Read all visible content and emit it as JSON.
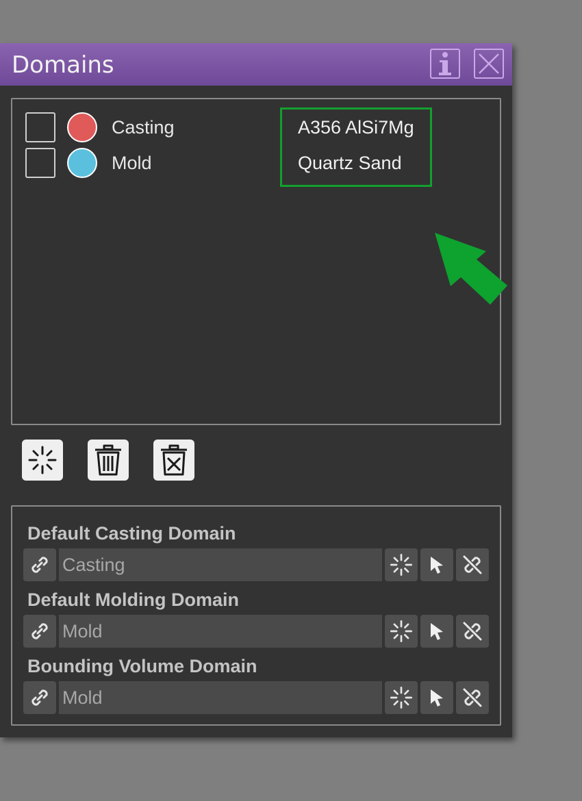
{
  "window": {
    "title": "Domains",
    "info_icon": "info-icon",
    "close_icon": "close-icon"
  },
  "domains": [
    {
      "name": "Casting",
      "material": "A356 AlSi7Mg",
      "color": "#e05a5a",
      "checked": false
    },
    {
      "name": "Mold",
      "material": "Quartz Sand",
      "color": "#5bc0de",
      "checked": false
    }
  ],
  "toolbar": {
    "new_icon": "sparkle-icon",
    "delete_icon": "trash-icon",
    "delete_all_icon": "trash-x-icon"
  },
  "defaults": [
    {
      "label": "Default Casting Domain",
      "value": "Casting"
    },
    {
      "label": "Default Molding Domain",
      "value": "Mold"
    },
    {
      "label": "Bounding Volume Domain",
      "value": "Mold"
    }
  ],
  "colors": {
    "titlebar": "#7b55a3",
    "highlight": "#12a02e",
    "arrow": "#0ea22f"
  }
}
